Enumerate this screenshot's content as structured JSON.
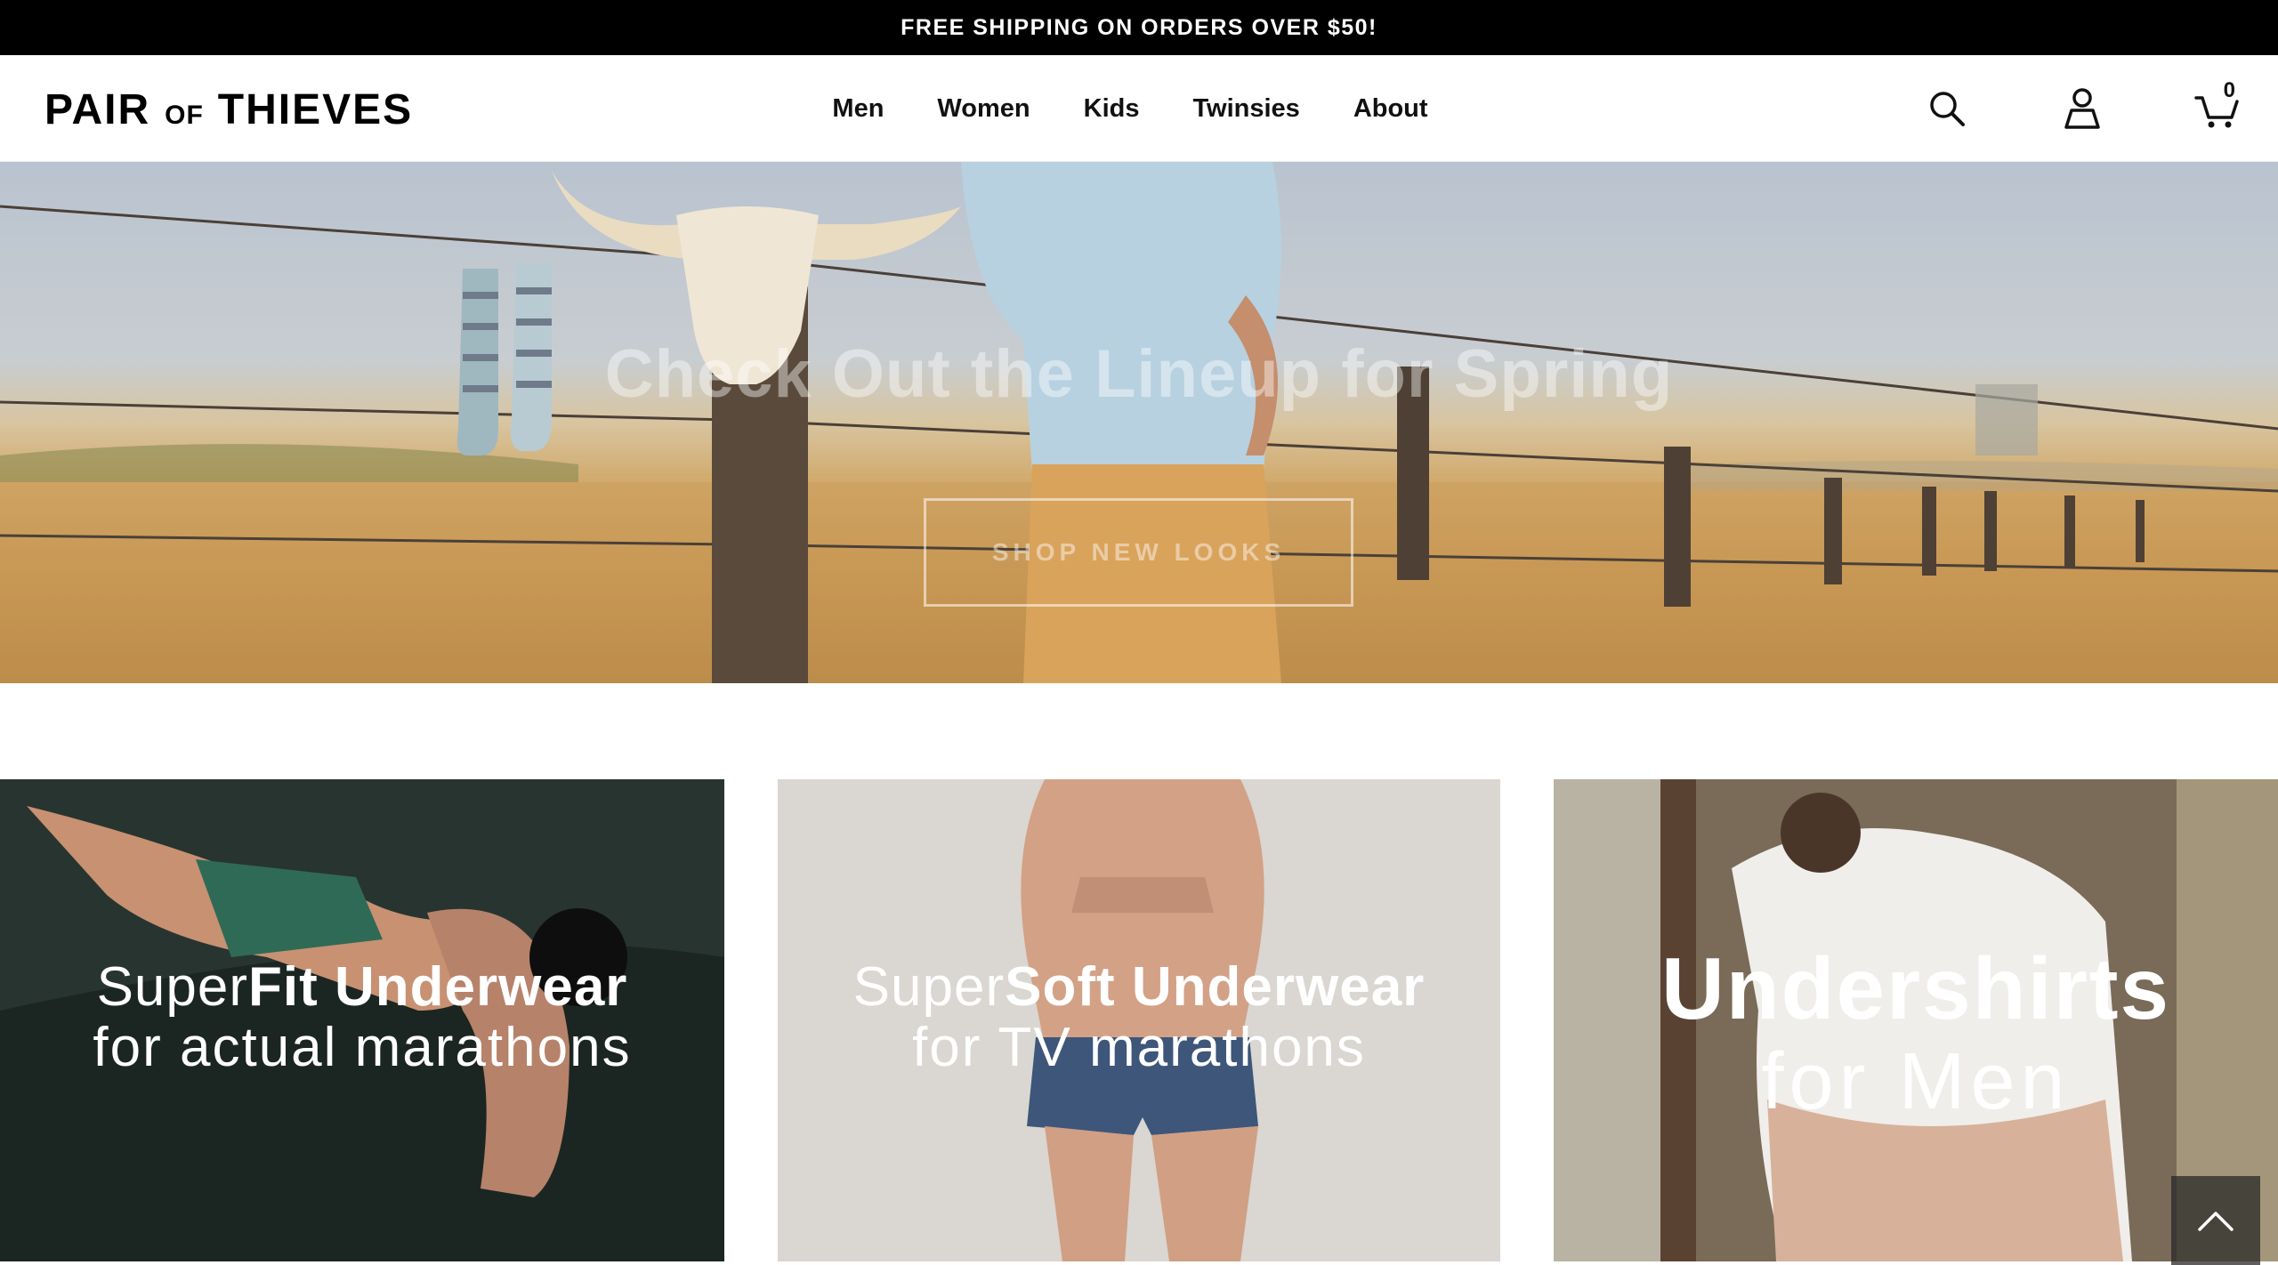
{
  "promo": {
    "text": "FREE SHIPPING ON ORDERS OVER $50!"
  },
  "header": {
    "logo": {
      "word1": "PAIR",
      "word2": "OF",
      "word3": "THIEVES"
    },
    "nav": [
      "Men",
      "Women",
      "Kids",
      "Twinsies",
      "About"
    ],
    "icons": [
      "search-icon",
      "account-icon",
      "cart-icon"
    ],
    "cart_count": "0"
  },
  "hero": {
    "title": "Check Out the Lineup for Spring",
    "cta": "SHOP NEW LOOKS"
  },
  "tiles": [
    {
      "line1_light": "Super",
      "line1_bold": "Fit Underwear",
      "line2": "for actual marathons"
    },
    {
      "line1_light": "Super",
      "line1_bold": "Soft Underwear",
      "line2": "for TV marathons"
    },
    {
      "line1": "Undershirts",
      "line2": "for Men"
    }
  ],
  "colors": {
    "promo_bg": "#000000",
    "text": "#111111",
    "accent_white": "#ffffff"
  }
}
